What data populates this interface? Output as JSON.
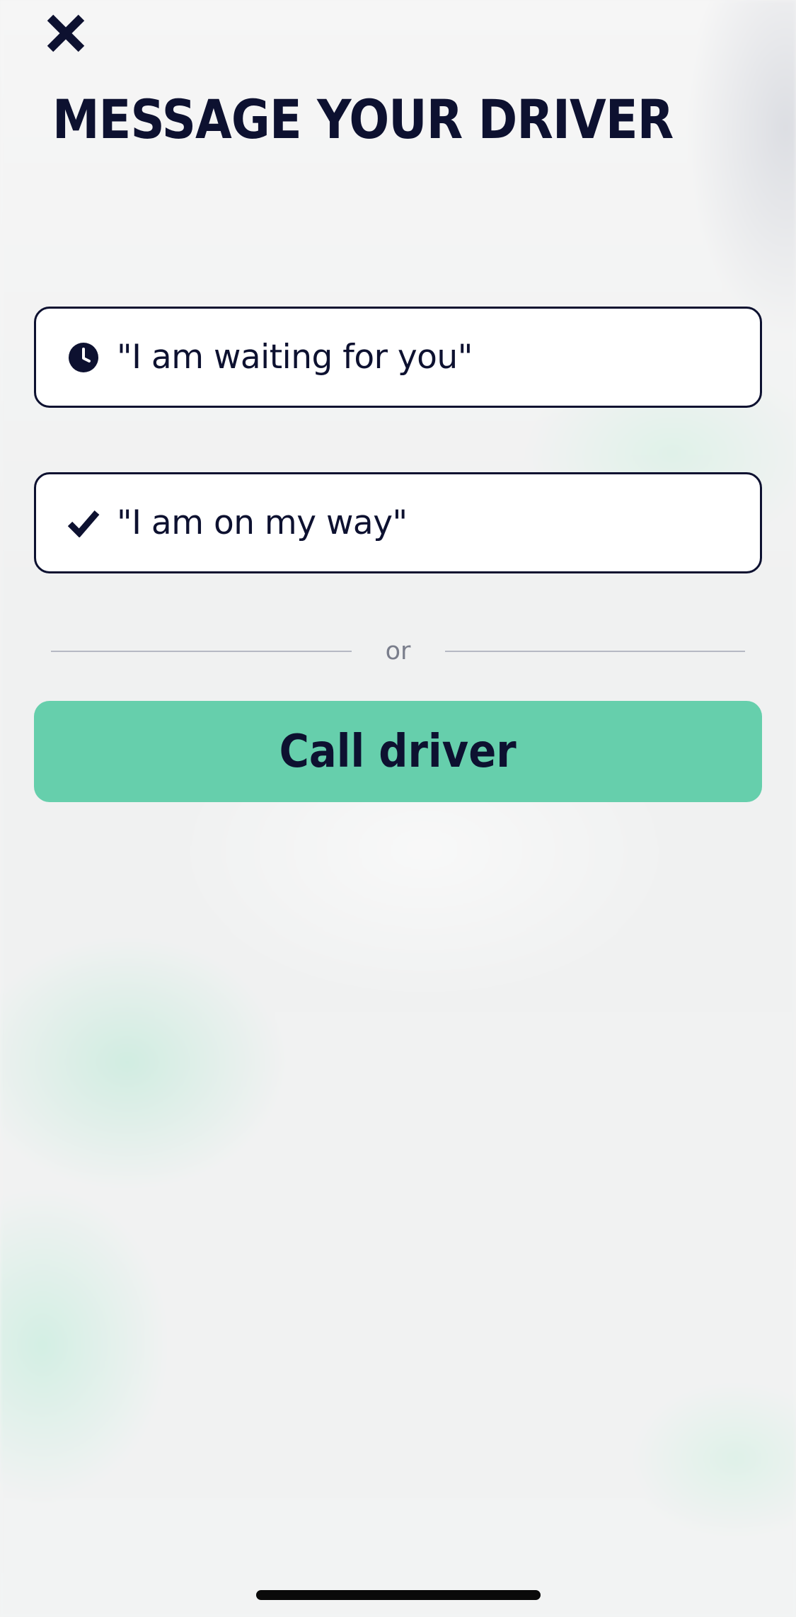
{
  "header": {
    "close_icon": "close-icon",
    "title": "MESSAGE YOUR DRIVER"
  },
  "messages": [
    {
      "icon": "clock-icon",
      "label": "\"I am waiting for you\""
    },
    {
      "icon": "checkmark-icon",
      "label": "\"I am on my way\""
    }
  ],
  "divider": {
    "text": "or"
  },
  "call_button": {
    "label": "Call driver",
    "color": "#66cfac"
  },
  "colors": {
    "text": "#0d1130",
    "accent": "#66cfac"
  }
}
